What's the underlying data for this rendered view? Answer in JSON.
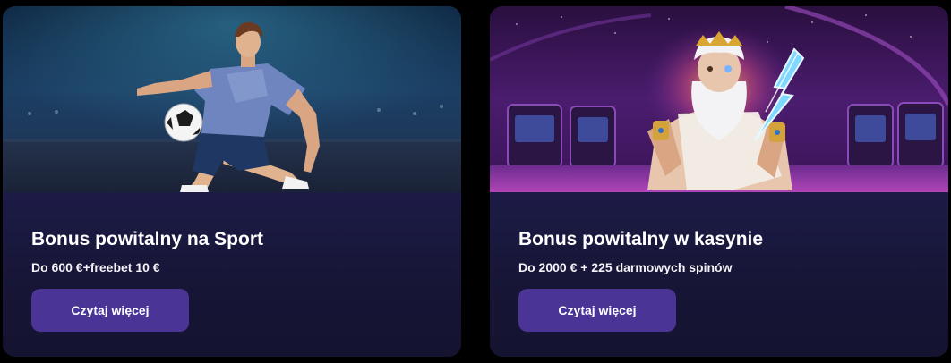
{
  "cards": [
    {
      "title": "Bonus powitalny na Sport",
      "subtitle": "Do 600 €+freebet 10 €",
      "button_label": "Czytaj więcej",
      "image_icon": "football-player-image"
    },
    {
      "title": "Bonus powitalny w kasynie",
      "subtitle": "Do 2000 € + 225 darmowych spinów",
      "button_label": "Czytaj więcej",
      "image_icon": "zeus-casino-image"
    }
  ],
  "colors": {
    "page_background": "#000000",
    "card_background": "#161535",
    "button_background": "#4a3597",
    "text": "#ffffff"
  }
}
